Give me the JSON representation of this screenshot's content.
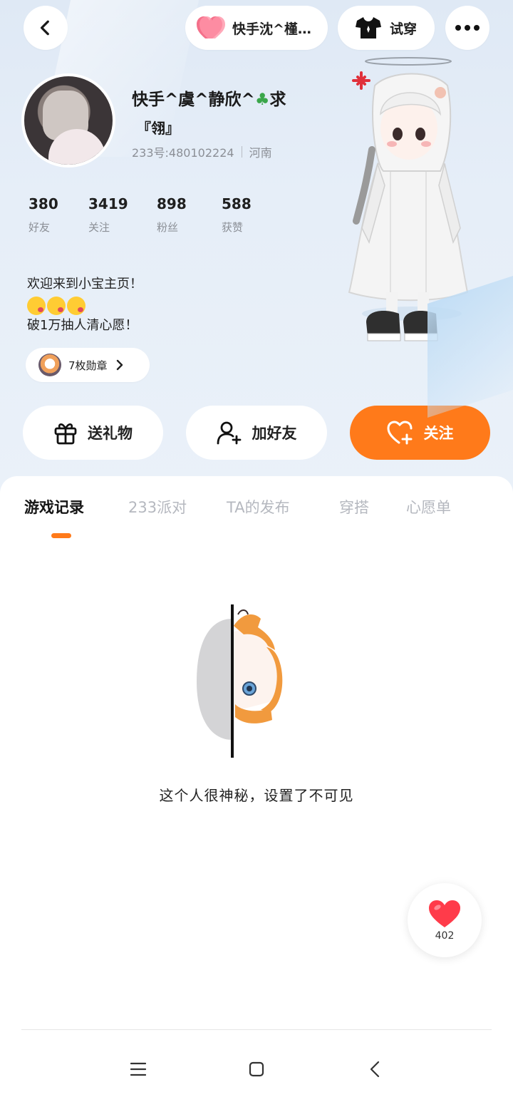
{
  "header": {
    "couple_label": "快手沈^槿…",
    "tryon_label": "试穿"
  },
  "profile": {
    "nickname": "快手^虞^静欣^",
    "nickname_suffix": "求",
    "subname": "『翎』",
    "id_text": "233号:480102224",
    "region": "河南"
  },
  "stats": [
    {
      "value": "380",
      "label": "好友"
    },
    {
      "value": "3419",
      "label": "关注"
    },
    {
      "value": "898",
      "label": "粉丝"
    },
    {
      "value": "588",
      "label": "获赞"
    }
  ],
  "bio": {
    "line1": "欢迎来到小宝主页！",
    "line3": "破1万抽人清心愿！"
  },
  "badges": {
    "label": "7枚勋章"
  },
  "actions": {
    "gift": "送礼物",
    "add_friend": "加好友",
    "follow": "关注"
  },
  "tabs": [
    {
      "label": "游戏记录",
      "active": true
    },
    {
      "label": "233派对",
      "active": false
    },
    {
      "label": "TA的发布",
      "active": false
    },
    {
      "label": "穿搭",
      "active": false
    },
    {
      "label": "心愿单",
      "active": false
    }
  ],
  "empty_state": {
    "text": "这个人很神秘，设置了不可见"
  },
  "like": {
    "count": "402"
  },
  "colors": {
    "accent": "#ff7a1a",
    "like_red": "#ff3b4a",
    "muted_text": "#8b8f96"
  },
  "icons": [
    "back-arrow-icon",
    "heart-icon",
    "tshirt-icon",
    "more-icon",
    "gift-icon",
    "add-user-icon",
    "heart-plus-icon",
    "chevron-right-icon",
    "menu-icon",
    "home-icon",
    "back-icon"
  ]
}
